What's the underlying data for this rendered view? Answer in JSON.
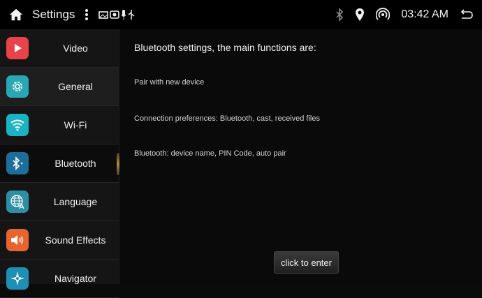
{
  "status_bar": {
    "title": "Settings",
    "time": "03:42 AM",
    "icons": [
      "home-icon",
      "more-vert-icon",
      "notification-icons",
      "bluetooth-icon",
      "location-icon",
      "hotspot-icon",
      "back-icon"
    ]
  },
  "sidebar": {
    "items": [
      {
        "label": "Video",
        "icon": "video-play-icon",
        "color": "#e8434a"
      },
      {
        "label": "General",
        "icon": "gear-icon",
        "color": "#2aa7b5"
      },
      {
        "label": "Wi-Fi",
        "icon": "wifi-icon",
        "color": "#19b3c4"
      },
      {
        "label": "Bluetooth",
        "icon": "bluetooth-icon",
        "color": "#1d6f9b"
      },
      {
        "label": "Language",
        "icon": "language-globe-icon",
        "color": "#2d8fa2"
      },
      {
        "label": "Sound Effects",
        "icon": "speaker-icon",
        "color": "#e8642e"
      },
      {
        "label": "Navigator",
        "icon": "compass-icon",
        "color": "#1e8fb5"
      }
    ],
    "selected_index": 1,
    "active_index": 3
  },
  "main": {
    "heading": "Bluetooth settings, the main functions are:",
    "lines": [
      "Pair with new device",
      "Connection preferences: Bluetooth, cast, received files",
      "Bluetooth: device name, PIN Code, auto pair"
    ],
    "enter_label": "click to enter"
  }
}
